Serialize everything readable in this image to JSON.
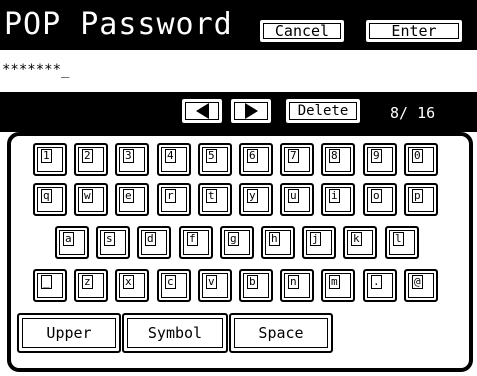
{
  "header": {
    "title": "POP Password",
    "cancel_label": "Cancel",
    "enter_label": "Enter"
  },
  "input": {
    "value": "*******_"
  },
  "toolbar": {
    "delete_label": "Delete",
    "counter": "8/ 16"
  },
  "keyboard": {
    "row1": [
      "1",
      "2",
      "3",
      "4",
      "5",
      "6",
      "7",
      "8",
      "9",
      "0"
    ],
    "row2": [
      "q",
      "w",
      "e",
      "r",
      "t",
      "y",
      "u",
      "i",
      "o",
      "p"
    ],
    "row3": [
      "a",
      "s",
      "d",
      "f",
      "g",
      "h",
      "j",
      "k",
      "l"
    ],
    "row4": [
      "_",
      "z",
      "x",
      "c",
      "v",
      "b",
      "n",
      "m",
      ".",
      "@"
    ],
    "modes": [
      "Upper",
      "Symbol",
      "Space"
    ]
  }
}
